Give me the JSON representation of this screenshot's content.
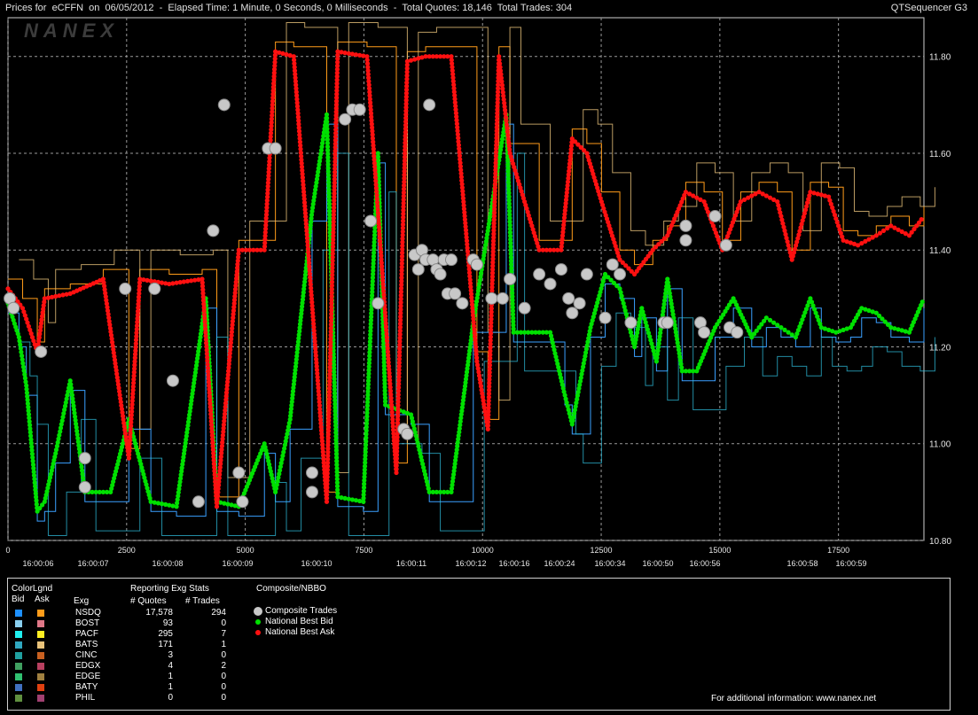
{
  "window": {
    "title": "Prices for  eCFFN  on  06/05/2012  -  Elapsed Time: 1 Minute, 0 Seconds, 0 Milliseconds  -  Total Quotes: 18,146  Total Trades: 304",
    "app_name": "QTSequencer G3"
  },
  "watermark": "NANEX",
  "footer_text": "For additional information: www.nanex.net",
  "colors": {
    "background": "#000000",
    "grid": "#9a9a9a",
    "nbb": "#00e000",
    "nbo": "#ff1010",
    "trade": "#c8c8c8",
    "nsdq_bid": "#3aa0ff",
    "nsdq_ask": "#ff9c1a",
    "pacf_ask": "#ffee22",
    "bats_ask": "#e8c27a"
  },
  "legend": {
    "colorlegend_title": "ColorLgnd",
    "bid_header": "Bid",
    "ask_header": "Ask",
    "stats_title": "Reporting Exg Stats",
    "exg_header": "Exg",
    "quotes_header": "# Quotes",
    "trades_header": "# Trades",
    "nbbo_title": "Composite/NBBO",
    "nbbo_items": [
      {
        "label": "Composite Trades",
        "color": "#c8c8c8"
      },
      {
        "label": "National Best Bid",
        "color": "#00e000"
      },
      {
        "label": "National Best Ask",
        "color": "#ff1010"
      }
    ],
    "rows": [
      {
        "exg": "NSDQ",
        "quotes": "17,578",
        "trades": "294",
        "bid_color": "#1e90ff",
        "ask_color": "#ff9c1a"
      },
      {
        "exg": "BOST",
        "quotes": "93",
        "trades": "0",
        "bid_color": "#8ad0f0",
        "ask_color": "#e07888"
      },
      {
        "exg": "PACF",
        "quotes": "295",
        "trades": "7",
        "bid_color": "#20f0f0",
        "ask_color": "#ffee22"
      },
      {
        "exg": "BATS",
        "quotes": "171",
        "trades": "1",
        "bid_color": "#30a8c0",
        "ask_color": "#e8c27a"
      },
      {
        "exg": "CINC",
        "quotes": "3",
        "trades": "0",
        "bid_color": "#20a0a0",
        "ask_color": "#c86020"
      },
      {
        "exg": "EDGX",
        "quotes": "4",
        "trades": "2",
        "bid_color": "#40a060",
        "ask_color": "#b84060"
      },
      {
        "exg": "EDGE",
        "quotes": "1",
        "trades": "0",
        "bid_color": "#30c070",
        "ask_color": "#a08040"
      },
      {
        "exg": "BATY",
        "quotes": "1",
        "trades": "0",
        "bid_color": "#4070c0",
        "ask_color": "#e04010"
      },
      {
        "exg": "PHIL",
        "quotes": "0",
        "trades": "0",
        "bid_color": "#609040",
        "ask_color": "#a04070"
      }
    ]
  },
  "chart_data": {
    "type": "line",
    "title": "",
    "xlabel": "",
    "ylabel": "",
    "xlim": [
      0,
      19300
    ],
    "ylim": [
      10.8,
      11.88
    ],
    "x_ticks": [
      "0",
      "2500",
      "5000",
      "7500",
      "10000",
      "12500",
      "15000",
      "17500"
    ],
    "x_tick_values": [
      0,
      2500,
      5000,
      7500,
      10000,
      12500,
      15000,
      17500
    ],
    "time_labels": [
      "16:00:06",
      "16:00:07",
      "16:00:08",
      "16:00:09",
      "16:00:10",
      "16:00:11",
      "16:00:12",
      "16:00:16",
      "16:00:24",
      "16:00:34",
      "16:00:50",
      "16:00:56",
      "16:00:58",
      "16:00:59"
    ],
    "time_label_x": [
      880,
      3380,
      5860,
      8240,
      10830,
      13500,
      15880,
      16500,
      17360,
      18150,
      19280,
      19860,
      21200,
      22030
    ],
    "y_ticks": [
      "11.80",
      "11.60",
      "11.40",
      "11.20",
      "11.00",
      "10.80"
    ],
    "y_tick_values": [
      11.8,
      11.6,
      11.4,
      11.2,
      11.0,
      10.8
    ],
    "series": [
      {
        "name": "National Best Bid",
        "color": "#00e000",
        "points": [
          [
            0,
            11.29
          ],
          [
            300,
            11.22
          ],
          [
            500,
            11.12
          ],
          [
            800,
            10.86
          ],
          [
            1000,
            10.88
          ],
          [
            1300,
            10.98
          ],
          [
            1700,
            11.13
          ],
          [
            2100,
            10.9
          ],
          [
            2800,
            10.9
          ],
          [
            3300,
            11.05
          ],
          [
            3900,
            10.88
          ],
          [
            4600,
            10.87
          ],
          [
            5400,
            11.3
          ],
          [
            5700,
            10.88
          ],
          [
            6300,
            10.87
          ],
          [
            7000,
            11.0
          ],
          [
            7300,
            10.9
          ],
          [
            7700,
            11.05
          ],
          [
            8300,
            11.48
          ],
          [
            8700,
            11.68
          ],
          [
            9000,
            10.89
          ],
          [
            9700,
            10.88
          ],
          [
            10100,
            11.6
          ],
          [
            10300,
            11.08
          ],
          [
            11000,
            11.06
          ],
          [
            11500,
            10.9
          ],
          [
            12100,
            10.9
          ],
          [
            12700,
            11.25
          ],
          [
            13600,
            11.68
          ],
          [
            13800,
            11.23
          ],
          [
            14800,
            11.23
          ],
          [
            15200,
            11.1
          ],
          [
            15400,
            11.04
          ],
          [
            15900,
            11.24
          ],
          [
            16300,
            11.35
          ],
          [
            16700,
            11.32
          ],
          [
            17100,
            11.2
          ],
          [
            17300,
            11.28
          ],
          [
            17700,
            11.17
          ],
          [
            18000,
            11.34
          ],
          [
            18400,
            11.15
          ],
          [
            18800,
            11.15
          ],
          [
            19300,
            11.24
          ],
          [
            19800,
            11.3
          ],
          [
            20300,
            11.22
          ],
          [
            20700,
            11.26
          ],
          [
            21100,
            11.24
          ],
          [
            21500,
            11.22
          ],
          [
            21900,
            11.3
          ],
          [
            22200,
            11.24
          ],
          [
            22600,
            11.23
          ],
          [
            23000,
            11.24
          ],
          [
            23300,
            11.28
          ],
          [
            23700,
            11.27
          ],
          [
            24100,
            11.24
          ],
          [
            24600,
            11.23
          ],
          [
            25000,
            11.3
          ]
        ]
      },
      {
        "name": "National Best Ask",
        "color": "#ff1010",
        "points": [
          [
            0,
            11.32
          ],
          [
            400,
            11.28
          ],
          [
            800,
            11.19
          ],
          [
            1000,
            11.3
          ],
          [
            1700,
            11.31
          ],
          [
            2600,
            11.34
          ],
          [
            3300,
            10.97
          ],
          [
            3600,
            11.34
          ],
          [
            4400,
            11.33
          ],
          [
            5300,
            11.34
          ],
          [
            5700,
            10.87
          ],
          [
            6300,
            11.4
          ],
          [
            7000,
            11.4
          ],
          [
            7300,
            11.81
          ],
          [
            7800,
            11.8
          ],
          [
            8700,
            10.88
          ],
          [
            9000,
            11.81
          ],
          [
            9800,
            11.8
          ],
          [
            10600,
            10.94
          ],
          [
            10900,
            11.79
          ],
          [
            11400,
            11.8
          ],
          [
            12100,
            11.8
          ],
          [
            12800,
            11.17
          ],
          [
            13100,
            11.03
          ],
          [
            13400,
            11.8
          ],
          [
            13700,
            11.6
          ],
          [
            14500,
            11.4
          ],
          [
            15100,
            11.4
          ],
          [
            15400,
            11.63
          ],
          [
            15800,
            11.6
          ],
          [
            16200,
            11.5
          ],
          [
            16700,
            11.38
          ],
          [
            17100,
            11.35
          ],
          [
            17600,
            11.4
          ],
          [
            18000,
            11.43
          ],
          [
            18500,
            11.52
          ],
          [
            19000,
            11.5
          ],
          [
            19500,
            11.4
          ],
          [
            20000,
            11.5
          ],
          [
            20500,
            11.52
          ],
          [
            21000,
            11.5
          ],
          [
            21400,
            11.38
          ],
          [
            21900,
            11.52
          ],
          [
            22400,
            11.51
          ],
          [
            22800,
            11.42
          ],
          [
            23200,
            11.41
          ],
          [
            23700,
            11.43
          ],
          [
            24100,
            11.45
          ],
          [
            24600,
            11.43
          ],
          [
            25000,
            11.47
          ]
        ]
      },
      {
        "name": "Composite Trades",
        "color": "#c8c8c8",
        "points": [
          [
            50,
            11.3
          ],
          [
            150,
            11.28
          ],
          [
            900,
            11.19
          ],
          [
            2100,
            10.97
          ],
          [
            2100,
            10.91
          ],
          [
            3200,
            11.32
          ],
          [
            4000,
            11.32
          ],
          [
            4500,
            11.13
          ],
          [
            5200,
            10.88
          ],
          [
            5600,
            11.44
          ],
          [
            5900,
            11.7
          ],
          [
            6300,
            10.94
          ],
          [
            6400,
            10.88
          ],
          [
            7100,
            11.61
          ],
          [
            7300,
            11.61
          ],
          [
            8300,
            10.94
          ],
          [
            8300,
            10.9
          ],
          [
            9200,
            11.67
          ],
          [
            9400,
            11.69
          ],
          [
            9600,
            11.69
          ],
          [
            9900,
            11.46
          ],
          [
            10100,
            11.29
          ],
          [
            10800,
            11.03
          ],
          [
            10900,
            11.02
          ],
          [
            11100,
            11.39
          ],
          [
            11200,
            11.36
          ],
          [
            11300,
            11.4
          ],
          [
            11400,
            11.38
          ],
          [
            11500,
            11.7
          ],
          [
            11600,
            11.38
          ],
          [
            11700,
            11.36
          ],
          [
            11800,
            11.35
          ],
          [
            11900,
            11.38
          ],
          [
            12000,
            11.31
          ],
          [
            12100,
            11.38
          ],
          [
            12200,
            11.31
          ],
          [
            12400,
            11.29
          ],
          [
            12700,
            11.38
          ],
          [
            12800,
            11.37
          ],
          [
            13200,
            11.3
          ],
          [
            13500,
            11.3
          ],
          [
            13700,
            11.34
          ],
          [
            14100,
            11.28
          ],
          [
            14500,
            11.35
          ],
          [
            14800,
            11.33
          ],
          [
            15100,
            11.36
          ],
          [
            15300,
            11.3
          ],
          [
            15400,
            11.27
          ],
          [
            15600,
            11.29
          ],
          [
            15800,
            11.35
          ],
          [
            16300,
            11.26
          ],
          [
            16500,
            11.37
          ],
          [
            16700,
            11.35
          ],
          [
            17000,
            11.25
          ],
          [
            17900,
            11.25
          ],
          [
            18000,
            11.25
          ],
          [
            18500,
            11.45
          ],
          [
            18500,
            11.42
          ],
          [
            18900,
            11.25
          ],
          [
            19000,
            11.23
          ],
          [
            19300,
            11.47
          ],
          [
            19600,
            11.41
          ],
          [
            19700,
            11.24
          ],
          [
            19900,
            11.23
          ]
        ]
      }
    ]
  }
}
